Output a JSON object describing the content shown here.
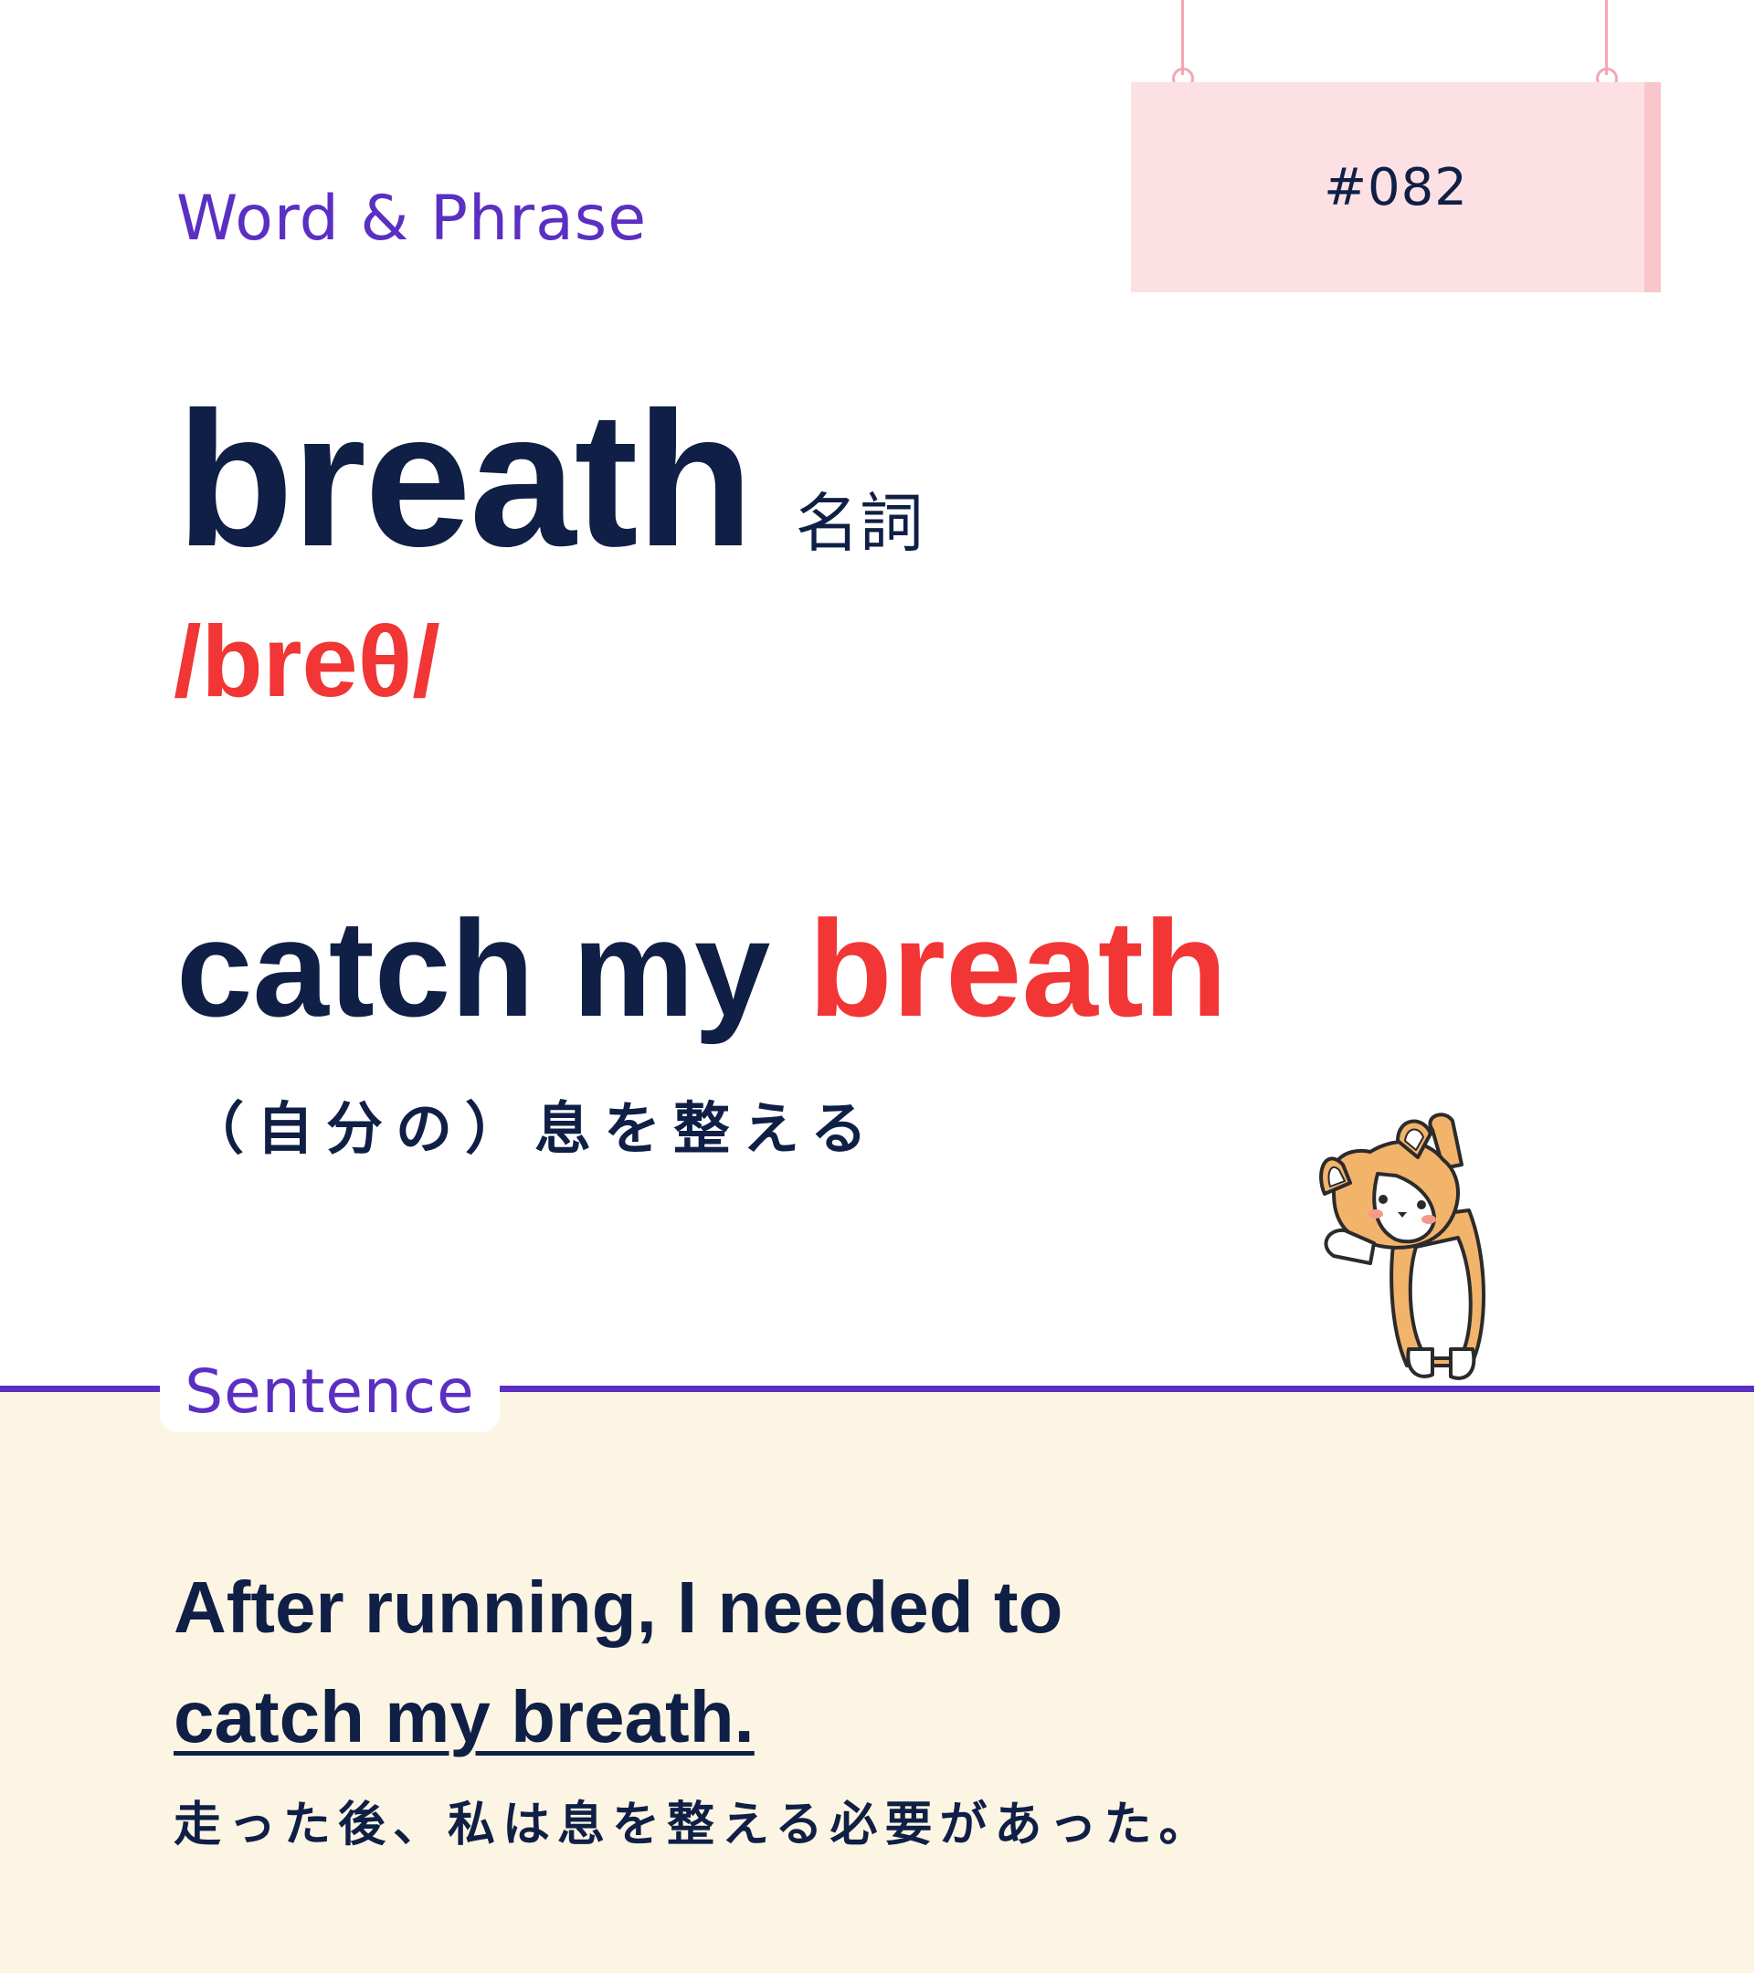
{
  "header": {
    "category_label": "Word & Phrase",
    "card_number": "#082"
  },
  "word": {
    "headword": "breath",
    "part_of_speech": "名詞",
    "pronunciation": "/breθ/"
  },
  "phrase": {
    "prefix": "catch my ",
    "highlight": "breath",
    "translation": "（自分の）息を整える"
  },
  "sentence_section": {
    "label": "Sentence",
    "line1": "After running, I needed to",
    "line2": "catch my breath.",
    "translation": "走った後、私は息を整える必要があった。"
  },
  "colors": {
    "navy": "#0f1f45",
    "red": "#f23535",
    "purple": "#5a2fc2",
    "pink_sign": "#fde0e3",
    "cream": "#fdf5e3"
  },
  "icons": {
    "mascot": "corgi-stretching-icon"
  }
}
